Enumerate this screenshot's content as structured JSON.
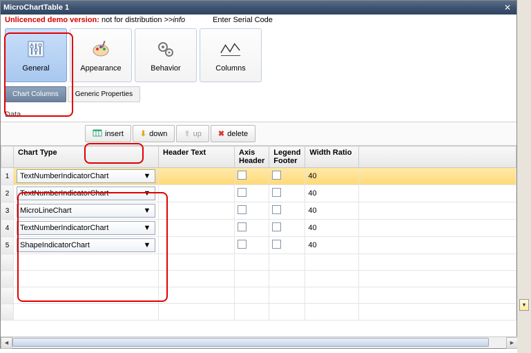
{
  "window": {
    "title": "MicroChartTable 1"
  },
  "notice": {
    "red": "Unlicenced demo version:",
    "black": "not for distribution",
    "info": ">>info",
    "serial": "Enter Serial Code"
  },
  "ribbon": {
    "general": "General",
    "appearance": "Appearance",
    "behavior": "Behavior",
    "columns": "Columns"
  },
  "subtabs": {
    "chart_columns": "Chart Columns",
    "generic_properties": "Generic Properties"
  },
  "section": "Data",
  "toolbar": {
    "insert": "insert",
    "down": "down",
    "up": "up",
    "delete": "delete"
  },
  "headers": {
    "chart_type": "Chart Type",
    "header_text": "Header Text",
    "axis_header": "Axis Header",
    "legend_footer": "Legend Footer",
    "width_ratio": "Width Ratio"
  },
  "rows": [
    {
      "n": "1",
      "type": "TextNumberIndicatorChart",
      "header": "",
      "axis": false,
      "legend": false,
      "width": "40",
      "selected": true
    },
    {
      "n": "2",
      "type": "TextNumberIndicatorChart",
      "header": "",
      "axis": false,
      "legend": false,
      "width": "40",
      "selected": false
    },
    {
      "n": "3",
      "type": "MicroLineChart",
      "header": "",
      "axis": false,
      "legend": false,
      "width": "40",
      "selected": false
    },
    {
      "n": "4",
      "type": "TextNumberIndicatorChart",
      "header": "",
      "axis": false,
      "legend": false,
      "width": "40",
      "selected": false
    },
    {
      "n": "5",
      "type": "ShapeIndicatorChart",
      "header": "",
      "axis": false,
      "legend": false,
      "width": "40",
      "selected": false
    }
  ]
}
